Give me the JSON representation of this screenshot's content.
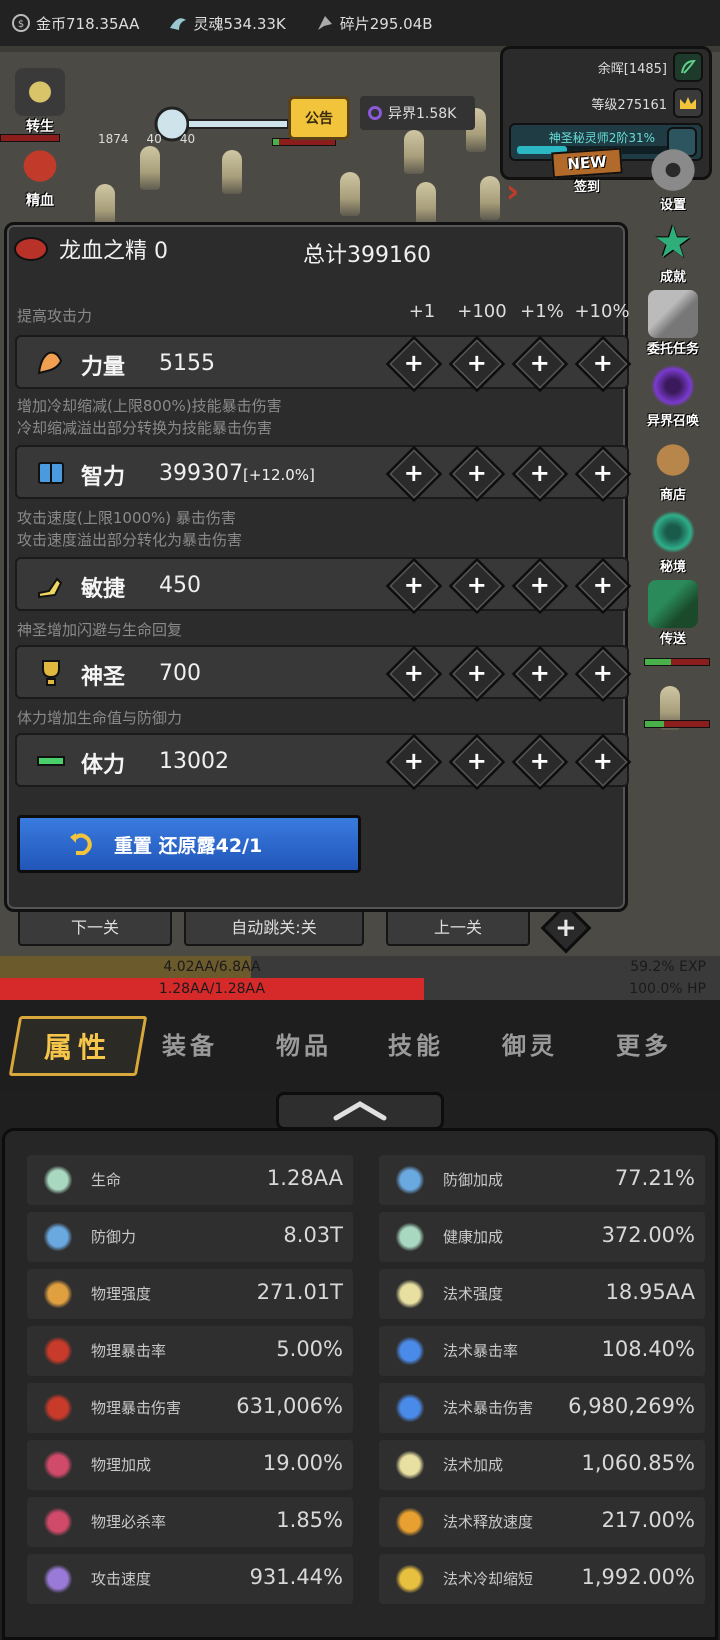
{
  "topbar": {
    "gold": "金币718.35AA",
    "soul": "灵魂534.33K",
    "shard": "碎片295.04B"
  },
  "scene": {
    "notice": "公告",
    "otherworld": "异界1.58K",
    "residual": "余晖[1485]",
    "level": "等级275161",
    "rank": "神圣秘灵师2阶31%",
    "rank_progress": 0.31,
    "weapon_stats": [
      "1874",
      "40",
      "40"
    ],
    "left_icons": [
      "转生",
      "精血"
    ],
    "right_icons": [
      "签到",
      "设置",
      "成就",
      "委托任务",
      "异界召唤",
      "商店",
      "秘境",
      "传送"
    ],
    "new_badge": "NEW",
    "level_buttons": [
      "下一关",
      "自动跳关:关",
      "上一关"
    ]
  },
  "attr_panel": {
    "title": "龙血之精 0",
    "total": "总计399160",
    "section_hint": "提高攻击力",
    "col_heads": [
      "+1",
      "+100",
      "+1%",
      "+10%"
    ],
    "rows": [
      {
        "name": "力量",
        "value": "5155",
        "bonus": ""
      },
      {
        "name": "智力",
        "value": "399307",
        "bonus": "[+12.0%]"
      },
      {
        "name": "敏捷",
        "value": "450",
        "bonus": ""
      },
      {
        "name": "神圣",
        "value": "700",
        "bonus": ""
      },
      {
        "name": "体力",
        "value": "13002",
        "bonus": ""
      }
    ],
    "descs": [
      "增加冷却缩减(上限800%)技能暴击伤害",
      "冷却缩减溢出部分转换为技能暴击伤害",
      "攻击速度(上限1000%) 暴击伤害",
      "攻击速度溢出部分转化为暴击伤害",
      "神圣增加闪避与生命回复",
      "体力增加生命值与防御力"
    ],
    "reset": "重置 还原露42/1"
  },
  "bars": {
    "exp_text": "4.02AA/6.8AA",
    "exp_pct": "59.2% EXP",
    "exp_fraction": 0.592,
    "hp_text": "1.28AA/1.28AA",
    "hp_pct": "100.0%  HP",
    "hp_fraction": 1.0
  },
  "tabs": [
    "属性",
    "装备",
    "物品",
    "技能",
    "御灵",
    "更多"
  ],
  "stats": [
    {
      "label": "生命",
      "value": "1.28AA",
      "icon": "cross-icon"
    },
    {
      "label": "防御加成",
      "value": "77.21%",
      "icon": "shield-icon"
    },
    {
      "label": "防御力",
      "value": "8.03T",
      "icon": "shield-icon"
    },
    {
      "label": "健康加成",
      "value": "372.00%",
      "icon": "cross-icon"
    },
    {
      "label": "物理强度",
      "value": "271.01T",
      "icon": "sword-icon"
    },
    {
      "label": "法术强度",
      "value": "18.95AA",
      "icon": "lightning-icon"
    },
    {
      "label": "物理暴击率",
      "value": "5.00%",
      "icon": "claw-icon"
    },
    {
      "label": "法术暴击率",
      "value": "108.40%",
      "icon": "blue-flame-icon"
    },
    {
      "label": "物理暴击伤害",
      "value": "631,006%",
      "icon": "claw-icon"
    },
    {
      "label": "法术暴击伤害",
      "value": "6,980,269%",
      "icon": "blue-flame-icon"
    },
    {
      "label": "物理加成",
      "value": "19.00%",
      "icon": "broken-sword-icon"
    },
    {
      "label": "法术加成",
      "value": "1,060.85%",
      "icon": "lightning-icon"
    },
    {
      "label": "物理必杀率",
      "value": "1.85%",
      "icon": "broken-sword-icon"
    },
    {
      "label": "法术释放速度",
      "value": "217.00%",
      "icon": "fire-icon"
    },
    {
      "label": "攻击速度",
      "value": "931.44%",
      "icon": "purple-sword-icon"
    },
    {
      "label": "法术冷却缩短",
      "value": "1,992.00%",
      "icon": "moon-icon"
    }
  ],
  "colors": {
    "exp": "#6b5a2c",
    "hp": "#d62a2a",
    "accent_gold": "#d8a93a",
    "reset_blue": "#2f6fd6"
  }
}
